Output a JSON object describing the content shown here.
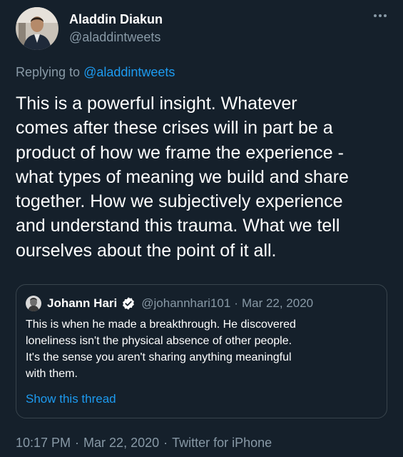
{
  "tweet": {
    "author": {
      "name": "Aladdin Diakun",
      "handle": "@aladdintweets"
    },
    "more_icon": "more-horizontal-icon",
    "reply": {
      "prefix": "Replying to ",
      "handle": "@aladdintweets"
    },
    "text_lines": [
      "This is a powerful insight. Whatever",
      "comes after these crises will in part be a",
      "product of how we frame the experience -",
      "what types of meaning we build and share",
      "together. How we subjectively experience",
      "and understand this trauma. What we tell",
      "ourselves about the point of it all."
    ],
    "quote": {
      "name": "Johann Hari",
      "verified_icon": "verified-badge-icon",
      "handle": "@johannhari101",
      "separator": "·",
      "date": "Mar 22, 2020",
      "text_lines": [
        "This is when he made a breakthrough. He discovered",
        "loneliness isn't the physical absence of other people.",
        "It's the sense you aren't sharing anything meaningful",
        "with them."
      ],
      "show_thread": "Show this thread"
    },
    "meta": {
      "time": "10:17 PM",
      "sep1": "·",
      "date": "Mar 22, 2020",
      "sep2": "·",
      "source": "Twitter for iPhone"
    },
    "colors": {
      "background": "#15202b",
      "text": "#ffffff",
      "muted": "#8899a6",
      "link": "#1d9bf0",
      "border": "#38444d"
    }
  }
}
